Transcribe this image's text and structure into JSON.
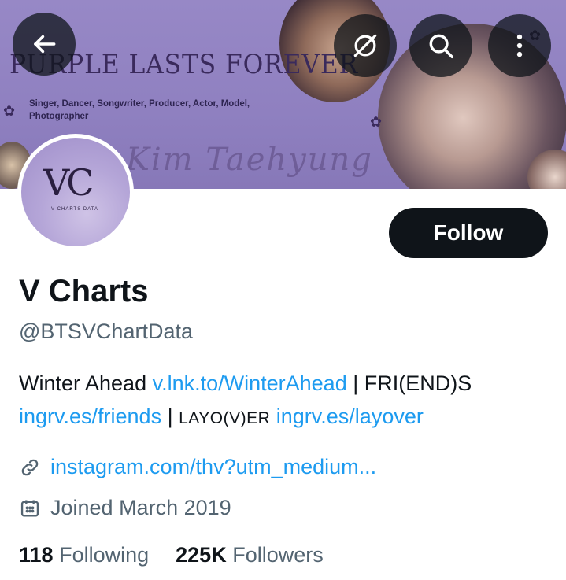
{
  "banner": {
    "title": "PURPLE LASTS FOREVER",
    "subtitle": "Singer, Dancer, Songwriter, Producer, Actor, Model, Photographer",
    "script_text": "Kim Taehyung"
  },
  "nav": {
    "back_icon": "arrow-left-icon",
    "grok_icon": "grok-icon",
    "search_icon": "search-icon",
    "more_icon": "more-vertical-icon"
  },
  "avatar": {
    "monogram": "VC",
    "small_text": "V CHARTS DATA"
  },
  "follow_label": "Follow",
  "profile": {
    "name": "V Charts",
    "handle": "@BTSVChartData"
  },
  "bio": {
    "part1": "Winter Ahead ",
    "link1": "v.lnk.to/WinterAhead",
    "part2": " | FRI(END)S",
    "link2": "ingrv.es/friends",
    "part3": " | ",
    "layover": "LAYO(V)ER",
    "link3": "ingrv.es/layover"
  },
  "website": "instagram.com/thv?utm_medium...",
  "joined": "Joined March 2019",
  "stats": {
    "following_count": "118",
    "following_label": "Following",
    "followers_count": "225K",
    "followers_label": "Followers"
  },
  "colors": {
    "accent": "#1d9bf0",
    "banner": "#9788c6",
    "follow_bg": "#0f1419"
  }
}
